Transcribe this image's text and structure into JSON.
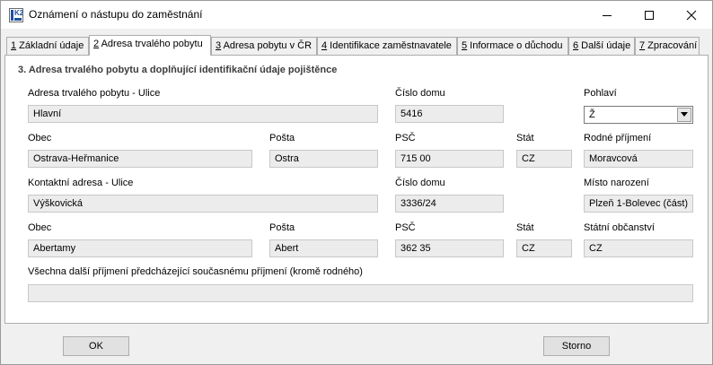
{
  "window": {
    "title": "Oznámení o nástupu do zaměstnání",
    "icon": "k2-app-icon"
  },
  "tabs": [
    {
      "num": "1",
      "label": " Základní údaje"
    },
    {
      "num": "2",
      "label": " Adresa trvalého pobytu"
    },
    {
      "num": "3",
      "label": " Adresa pobytu v ČR"
    },
    {
      "num": "4",
      "label": " Identifikace zaměstnavatele"
    },
    {
      "num": "5",
      "label": " Informace o důchodu"
    },
    {
      "num": "6",
      "label": " Další údaje"
    },
    {
      "num": "7",
      "label": " Zpracování"
    }
  ],
  "active_tab": 1,
  "section_title": "3. Adresa trvalého pobytu a doplňující identifikační údaje pojištěnce",
  "form": {
    "street": {
      "label": "Adresa trvalého pobytu - Ulice",
      "value": "Hlavní"
    },
    "house_no": {
      "label": "Číslo domu",
      "value": "5416"
    },
    "gender": {
      "label": "Pohlaví",
      "value": "Ž"
    },
    "city": {
      "label": "Obec",
      "value": "Ostrava-Heřmanice"
    },
    "post": {
      "label": "Pošta",
      "value": "Ostra"
    },
    "zip": {
      "label": "PSČ",
      "value": "715 00"
    },
    "country": {
      "label": "Stát",
      "value": "CZ"
    },
    "birth_name": {
      "label": "Rodné příjmení",
      "value": "Moravcová"
    },
    "contact_street": {
      "label": "Kontaktní adresa - Ulice",
      "value": "Výškovická"
    },
    "contact_house_no": {
      "label": "Číslo domu",
      "value": "3336/24"
    },
    "birth_place": {
      "label": "Místo narození",
      "value": "Plzeň 1-Bolevec (část)"
    },
    "contact_city": {
      "label": "Obec",
      "value": "Abertamy"
    },
    "contact_post": {
      "label": "Pošta",
      "value": "Abert"
    },
    "contact_zip": {
      "label": "PSČ",
      "value": "362 35"
    },
    "contact_country": {
      "label": "Stát",
      "value": "CZ"
    },
    "citizenship": {
      "label": "Státní občanství",
      "value": "CZ"
    },
    "other_surnames": {
      "label": "Všechna další příjmení předcházející současnému příjmení (kromě rodného)",
      "value": ""
    }
  },
  "buttons": {
    "ok": "OK",
    "cancel": "Storno"
  }
}
